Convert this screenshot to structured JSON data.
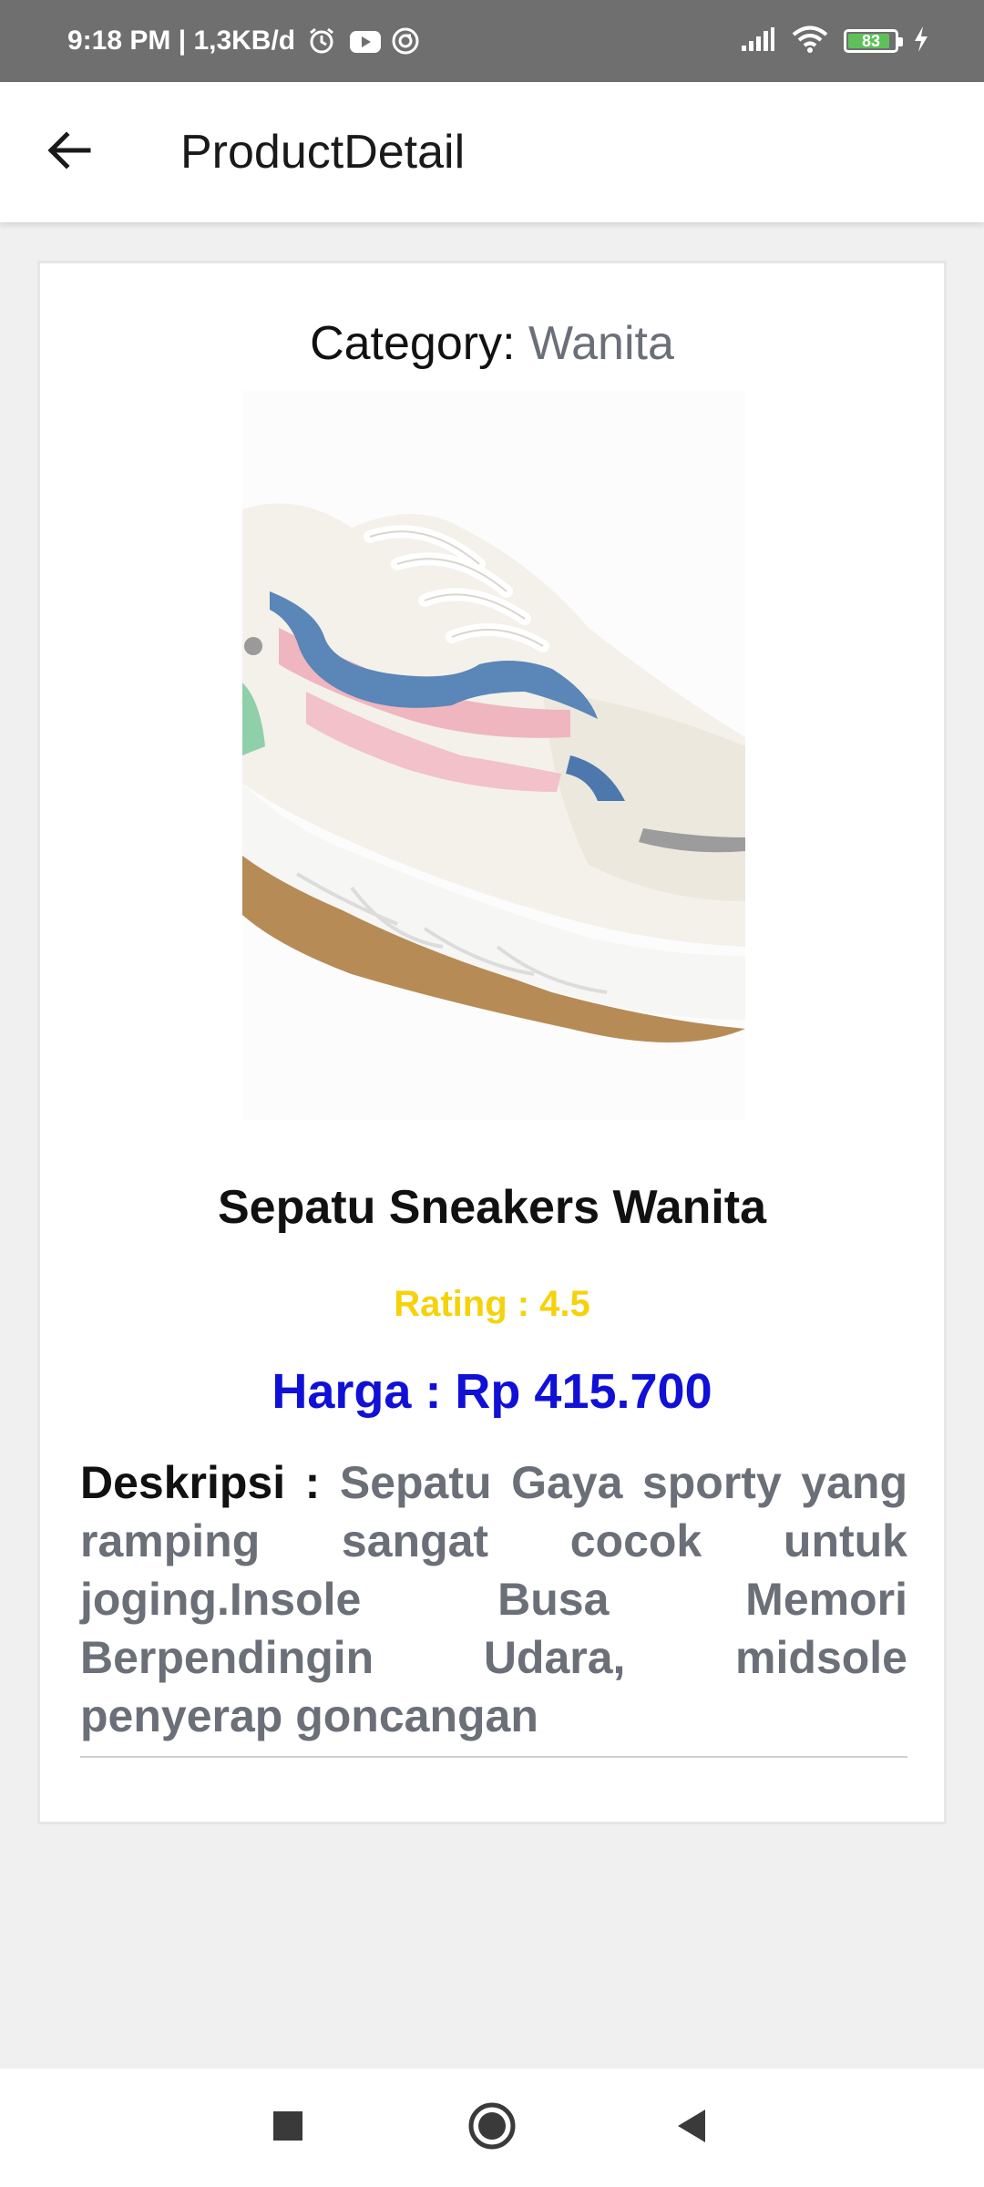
{
  "status_bar": {
    "time_info": "9:18 PM | 1,3KB/d",
    "battery": "83",
    "battery_level": 0.83
  },
  "app_bar": {
    "title": "ProductDetail"
  },
  "product": {
    "category_label": "Category:",
    "category_value": "Wanita",
    "name": "Sepatu Sneakers Wanita",
    "rating": "Rating : 4.5",
    "price": "Harga : Rp 415.700",
    "description_label": "Deskripsi :",
    "description_text": "Sepatu Gaya sporty yang ramping sangat cocok untuk joging.Insole Busa Memori Berpendingin Udara, midsole penyerap goncangan"
  },
  "colors": {
    "rating": "#f5d20a",
    "price": "#1010d6",
    "muted_text": "#6b6f78"
  },
  "icons": {
    "back": "arrow-left-icon",
    "nav_recent": "square-icon",
    "nav_home": "circle-icon",
    "nav_back": "triangle-icon"
  }
}
